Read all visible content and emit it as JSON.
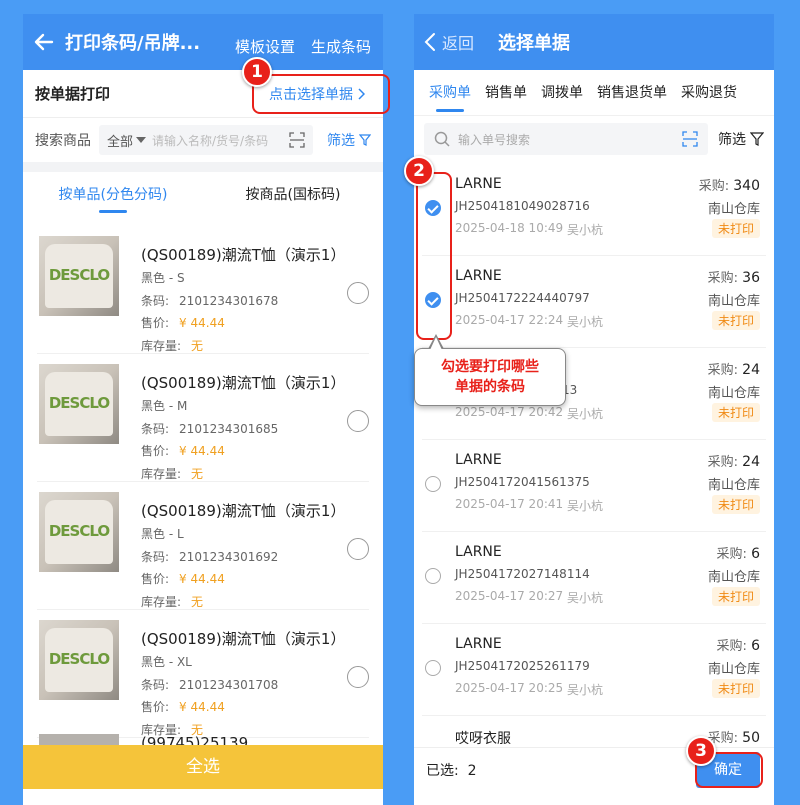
{
  "left": {
    "header": {
      "title": "打印条码/吊牌...",
      "template_link": "模板设置",
      "generate_link": "生成条码"
    },
    "order_print": {
      "label": "按单据打印",
      "select_link": "点击选择单据"
    },
    "search": {
      "label": "搜索商品",
      "category": "全部",
      "placeholder": "请输入名称/货号/条码",
      "filter": "筛选"
    },
    "tabs": [
      "按单品(分色分码)",
      "按商品(国标码)"
    ],
    "products": [
      {
        "name": "(QS00189)潮流T恤（演示1）",
        "variant": "黑色 - S",
        "barcode_label": "条码:",
        "barcode": "2101234301678",
        "price_label": "售价:",
        "price": "¥ 44.44",
        "stock_label": "库存量:",
        "stock": "无",
        "image_text": "DESCLO"
      },
      {
        "name": "(QS00189)潮流T恤（演示1）",
        "variant": "黑色 - M",
        "barcode_label": "条码:",
        "barcode": "2101234301685",
        "price_label": "售价:",
        "price": "¥ 44.44",
        "stock_label": "库存量:",
        "stock": "无",
        "image_text": "DESCLO"
      },
      {
        "name": "(QS00189)潮流T恤（演示1）",
        "variant": "黑色 - L",
        "barcode_label": "条码:",
        "barcode": "2101234301692",
        "price_label": "售价:",
        "price": "¥ 44.44",
        "stock_label": "库存量:",
        "stock": "无",
        "image_text": "DESCLO"
      },
      {
        "name": "(QS00189)潮流T恤（演示1）",
        "variant": "黑色 - XL",
        "barcode_label": "条码:",
        "barcode": "2101234301708",
        "price_label": "售价:",
        "price": "¥ 44.44",
        "stock_label": "库存量:",
        "stock": "无",
        "image_text": "DESCLO"
      }
    ],
    "partial_product": "(99745)25139",
    "select_all": "全选"
  },
  "right": {
    "header": {
      "back": "返回",
      "title": "选择单据"
    },
    "tabs": [
      "采购单",
      "销售单",
      "调拨单",
      "销售退货单",
      "采购退货"
    ],
    "search_placeholder": "输入单号搜索",
    "filter": "筛选",
    "orders": [
      {
        "supplier": "LARNE",
        "no": "JH2504181049028716",
        "time": "2025-04-18 10:49",
        "operator": "吴小杭",
        "qty_label": "采购:",
        "qty": "340",
        "warehouse": "南山仓库",
        "status": "未打印",
        "checked": true
      },
      {
        "supplier": "LARNE",
        "no": "JH2504172224440797",
        "time": "2025-04-17 22:24",
        "operator": "吴小杭",
        "qty_label": "采购:",
        "qty": "36",
        "warehouse": "南山仓库",
        "status": "未打印",
        "checked": true
      },
      {
        "supplier": "",
        "no": "13",
        "time": "2025-04-17 20:42",
        "operator": "吴小杭",
        "qty_label": "采购:",
        "qty": "24",
        "warehouse": "南山仓库",
        "status": "未打印",
        "checked": false
      },
      {
        "supplier": "LARNE",
        "no": "JH2504172041561375",
        "time": "2025-04-17 20:41",
        "operator": "吴小杭",
        "qty_label": "采购:",
        "qty": "24",
        "warehouse": "南山仓库",
        "status": "未打印",
        "checked": false
      },
      {
        "supplier": "LARNE",
        "no": "JH2504172027148114",
        "time": "2025-04-17 20:27",
        "operator": "吴小杭",
        "qty_label": "采购:",
        "qty": "6",
        "warehouse": "南山仓库",
        "status": "未打印",
        "checked": false
      },
      {
        "supplier": "LARNE",
        "no": "JH2504172025261179",
        "time": "2025-04-17 20:25",
        "operator": "吴小杭",
        "qty_label": "采购:",
        "qty": "6",
        "warehouse": "南山仓库",
        "status": "未打印",
        "checked": false
      }
    ],
    "partial_order": {
      "supplier": "哎呀衣服",
      "qty_label": "采购:",
      "qty": "50"
    },
    "footer": {
      "selected_label": "已选:",
      "selected_count": "2",
      "confirm": "确定"
    }
  },
  "annotations": {
    "step1": "1",
    "step2": "2",
    "step3": "3",
    "callout_line1": "勾选要打印哪些",
    "callout_line2": "单据的条码",
    "accent_color": "#e8211a"
  }
}
